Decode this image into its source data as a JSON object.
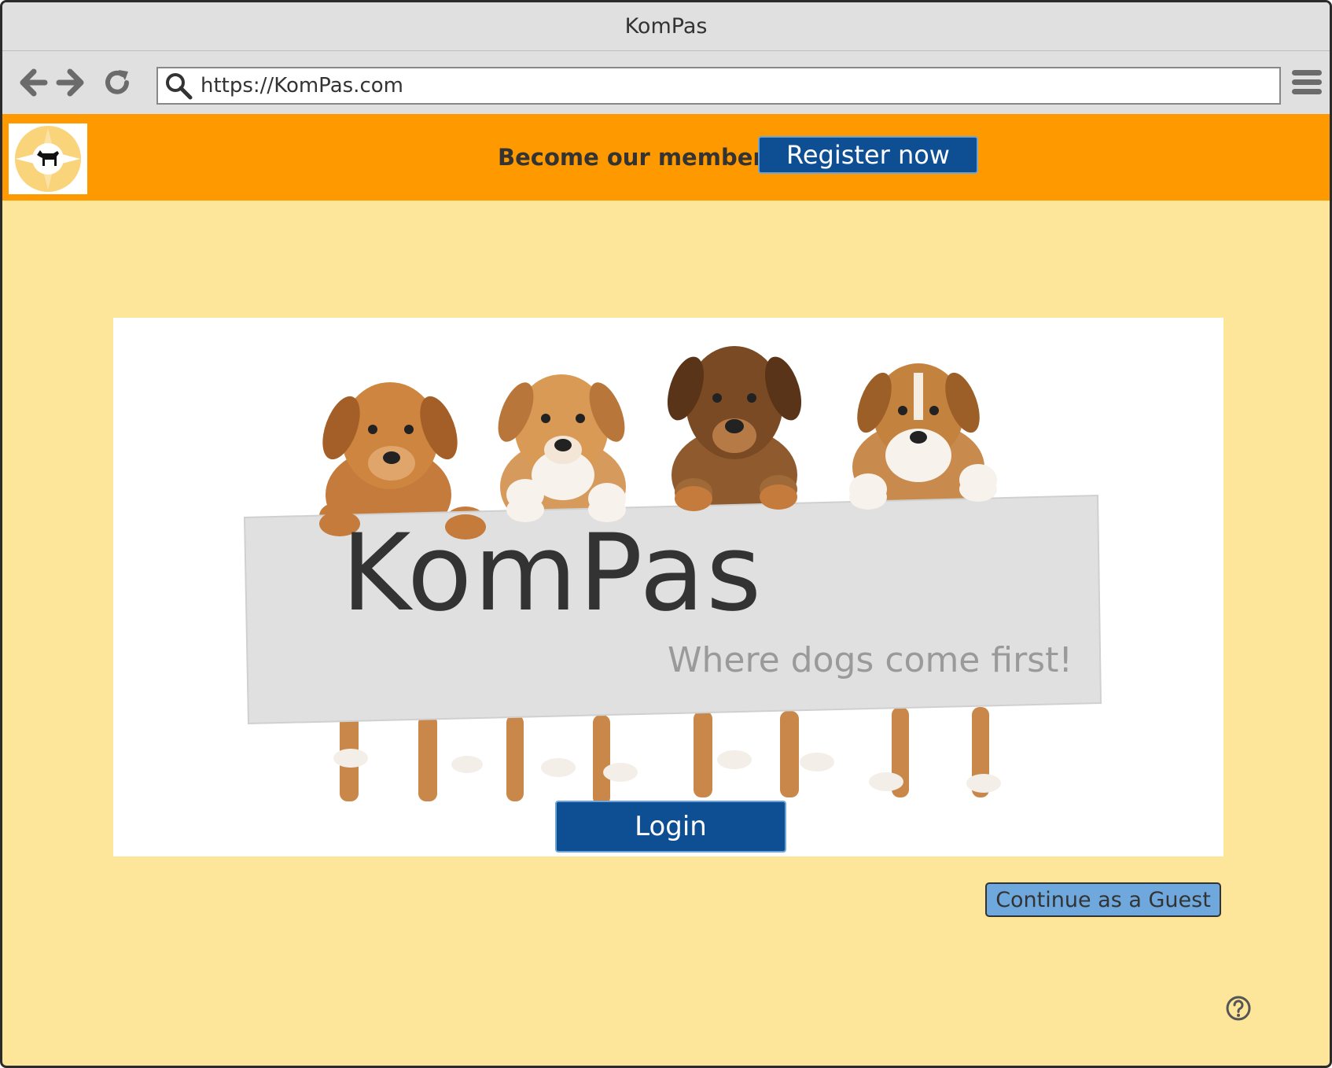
{
  "window": {
    "title": "KomPas"
  },
  "browser": {
    "url": "https://KomPas.com",
    "back_icon": "arrow-left-icon",
    "forward_icon": "arrow-right-icon",
    "reload_icon": "reload-icon",
    "menu_icon": "hamburger-menu-icon"
  },
  "banner": {
    "promo_text": "Become our member!",
    "register_label": "Register now",
    "logo_icon": "dog-compass-logo"
  },
  "hero": {
    "title": "KomPas",
    "tagline": "Where dogs come first!",
    "login_label": "Login"
  },
  "guest_label": "Continue as a Guest",
  "help_icon": "help-circle-icon",
  "colors": {
    "page_bg": "#fde599",
    "banner_bg": "#ff9900",
    "primary_button": "#0e4f93",
    "guest_button": "#6fa8dc"
  }
}
